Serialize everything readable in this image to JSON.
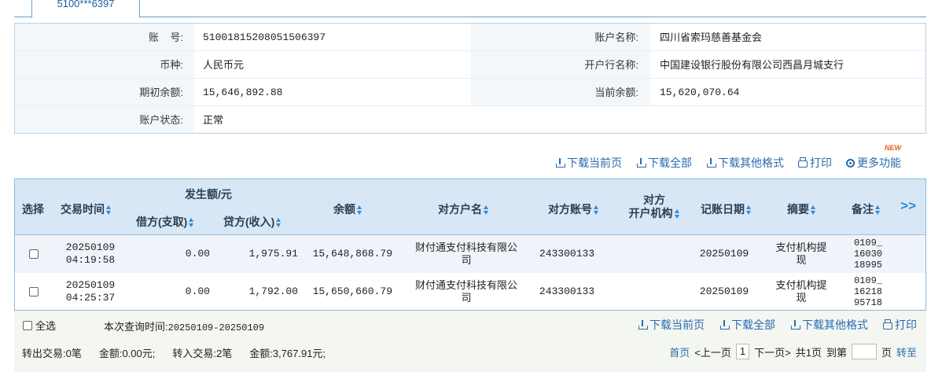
{
  "tab": {
    "label": "5100***6397"
  },
  "account": {
    "account_no_label": "账    号:",
    "account_no": "51001815208051506397",
    "account_name_label": "账户名称:",
    "account_name": "四川省索玛慈善基金会",
    "currency_label": "币种:",
    "currency": "人民币元",
    "bank_label": "开户行名称:",
    "bank": "中国建设银行股份有限公司西昌月城支行",
    "opening_balance_label": "期初余额:",
    "opening_balance": "15,646,892.88",
    "current_balance_label": "当前余额:",
    "current_balance": "15,620,070.64",
    "status_label": "账户状态:",
    "status": "正常"
  },
  "toolbar": {
    "download_page": "下载当前页",
    "download_all": "下载全部",
    "download_other": "下载其他格式",
    "print": "打印",
    "more": "更多功能",
    "new_badge": "NEW"
  },
  "table": {
    "headers": {
      "select": "选择",
      "time": "交易时间",
      "amount_group": "发生额/元",
      "debit": "借方(支取)",
      "credit": "贷方(收入)",
      "balance": "余额",
      "counterparty_name": "对方户名",
      "counterparty_account": "对方账号",
      "counterparty_bank_1": "对方",
      "counterparty_bank_2": "开户机构",
      "posting_date": "记账日期",
      "summary": "摘要",
      "remark": "备注",
      "more_cols": ">>"
    },
    "rows": [
      {
        "date": "20250109",
        "time": "04:19:58",
        "debit": "0.00",
        "credit": "1,975.91",
        "balance": "15,648,868.79",
        "cp_name_1": "财付通支付科技有限公",
        "cp_name_2": "司",
        "cp_account": "243300133",
        "posting_date": "20250109",
        "summary_1": "支付机构提",
        "summary_2": "现",
        "remark_1": "0109_",
        "remark_2": "16030",
        "remark_3": "18995"
      },
      {
        "date": "20250109",
        "time": "04:25:37",
        "debit": "0.00",
        "credit": "1,792.00",
        "balance": "15,650,660.79",
        "cp_name_1": "财付通支付科技有限公",
        "cp_name_2": "司",
        "cp_account": "243300133",
        "posting_date": "20250109",
        "summary_1": "支付机构提",
        "summary_2": "现",
        "remark_1": "0109_",
        "remark_2": "16218",
        "remark_3": "95718"
      }
    ]
  },
  "footer": {
    "select_all": "全选",
    "query_time_label": "本次查询时间:",
    "query_time": "20250109-20250109",
    "download_page": "下载当前页",
    "download_all": "下载全部",
    "download_other": "下载其他格式",
    "print": "打印",
    "out_tx": "转出交易:0笔",
    "out_amount": "金额:0.00元;",
    "in_tx": "转入交易:2笔",
    "in_amount": "金额:3,767.91元;"
  },
  "pager": {
    "first": "首页",
    "prev": "<上一页",
    "current": "1",
    "next": "下一页>",
    "total": "共1页",
    "goto_prefix": "到第",
    "goto_suffix": "页",
    "go": "转至"
  }
}
